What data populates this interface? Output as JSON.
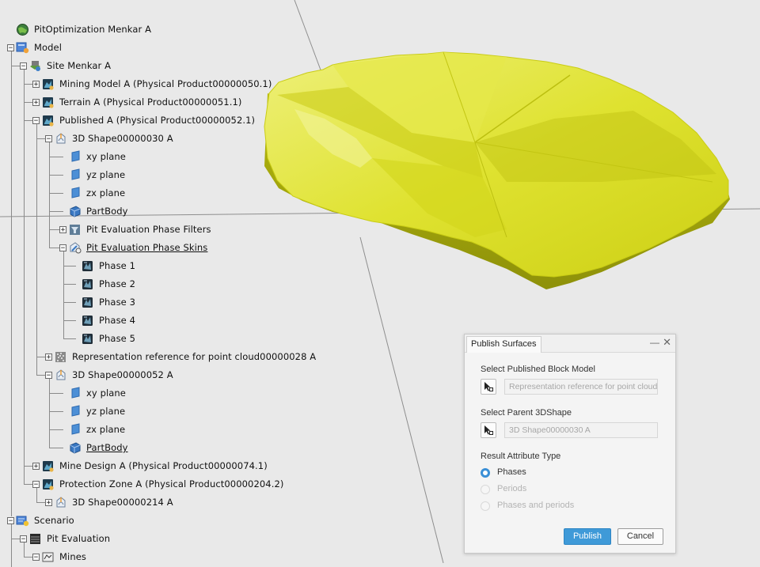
{
  "tree": {
    "items": [
      {
        "label": "PitOptimization Menkar A",
        "icon": "globe-icon",
        "expander": ""
      },
      {
        "label": "Model",
        "icon": "model-icon",
        "expander": "−"
      },
      {
        "label": "Site Menkar A",
        "icon": "site-icon",
        "expander": "−"
      },
      {
        "label": "Mining Model A (Physical Product00000050.1)",
        "icon": "product-icon",
        "expander": "+"
      },
      {
        "label": "Terrain A (Physical Product00000051.1)",
        "icon": "product-icon",
        "expander": "+"
      },
      {
        "label": "Published A (Physical Product00000052.1)",
        "icon": "product-icon",
        "expander": "−"
      },
      {
        "label": "3D Shape00000030 A",
        "icon": "shape-icon",
        "expander": "−"
      },
      {
        "label": "xy plane",
        "icon": "plane-icon",
        "expander": ""
      },
      {
        "label": "yz plane",
        "icon": "plane-icon",
        "expander": ""
      },
      {
        "label": "zx plane",
        "icon": "plane-icon",
        "expander": ""
      },
      {
        "label": "PartBody",
        "icon": "partbody-icon",
        "expander": ""
      },
      {
        "label": "Pit Evaluation Phase Filters",
        "icon": "filters-icon",
        "expander": "+"
      },
      {
        "label": "Pit Evaluation Phase Skins",
        "icon": "skins-icon",
        "expander": "−"
      },
      {
        "label": "Phase 1",
        "icon": "phase-icon",
        "expander": ""
      },
      {
        "label": "Phase 2",
        "icon": "phase-icon",
        "expander": ""
      },
      {
        "label": "Phase 3",
        "icon": "phase-icon",
        "expander": ""
      },
      {
        "label": "Phase 4",
        "icon": "phase-icon",
        "expander": ""
      },
      {
        "label": "Phase 5",
        "icon": "phase-icon",
        "expander": ""
      },
      {
        "label": "Representation reference for point cloud00000028 A",
        "icon": "pointcloud-icon",
        "expander": "+"
      },
      {
        "label": "3D Shape00000052 A",
        "icon": "shape-icon",
        "expander": "−"
      },
      {
        "label": "xy plane",
        "icon": "plane-icon",
        "expander": ""
      },
      {
        "label": "yz plane",
        "icon": "plane-icon",
        "expander": ""
      },
      {
        "label": "zx plane",
        "icon": "plane-icon",
        "expander": ""
      },
      {
        "label": "PartBody",
        "icon": "partbody-icon",
        "expander": ""
      },
      {
        "label": "Mine Design A (Physical Product00000074.1)",
        "icon": "product-icon",
        "expander": "+"
      },
      {
        "label": "Protection Zone A (Physical Product00000204.2)",
        "icon": "product-icon",
        "expander": "−"
      },
      {
        "label": "3D Shape00000214 A",
        "icon": "shape-icon",
        "expander": "+"
      },
      {
        "label": "Scenario",
        "icon": "scenario-icon",
        "expander": "−"
      },
      {
        "label": "Pit Evaluation",
        "icon": "pit-evaluation-icon",
        "expander": "−"
      },
      {
        "label": "Mines",
        "icon": "mines-icon",
        "expander": "−"
      }
    ]
  },
  "viewport": {
    "surface_color": "#d8dc1c",
    "background_color": "#e9e9e9"
  },
  "dialog": {
    "title": "Publish Surfaces",
    "minimize_glyph": "—",
    "close_glyph": "✕",
    "block_model_label": "Select Published Block Model",
    "block_model_value": "Representation reference for point cloud",
    "parent_label": "Select Parent 3DShape",
    "parent_value": "3D Shape00000030 A",
    "result_label": "Result Attribute Type",
    "options": [
      {
        "label": "Phases",
        "selected": true,
        "enabled": true
      },
      {
        "label": "Periods",
        "selected": false,
        "enabled": false
      },
      {
        "label": "Phases and periods",
        "selected": false,
        "enabled": false
      }
    ],
    "publish_label": "Publish",
    "cancel_label": "Cancel",
    "accent_color": "#3f9ad8"
  }
}
